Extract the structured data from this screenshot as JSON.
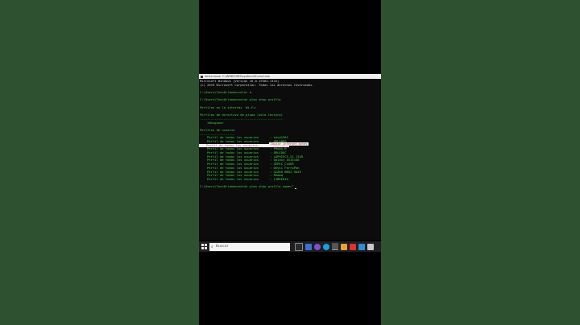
{
  "window": {
    "title": "Seleccionar C:\\WINDOWS\\system32\\cmd.exe"
  },
  "header_lines": [
    "Microsoft Windows [Versión 10.0.19363.1316]",
    "(c) 2019 Microsoft Corporation. Todos los derechos reservados.",
    "",
    "C:\\Users\\TecnOrlando>color a",
    "",
    "C:\\Users\\TecnOrlando>netsh wlan show profile",
    "",
    "Perfiles en la interfaz  Wi-Fi:",
    "",
    "Perfiles de directiva de grupo (solo lectura)",
    "---------------------------------------------",
    "    <Ninguno>",
    "",
    "Perfiles de usuario",
    "-------------------"
  ],
  "profiles": [
    {
      "label": "Perfil de todos los usuarios",
      "value": ": sesd1561"
    },
    {
      "label": "Perfil de todos los usuarios",
      "value": ": ORLANDO"
    },
    {
      "label": "Perfil de todos los usuarios",
      "value": ": MEGACABLE"
    },
    {
      "label": "Perfil de todos los usuarios",
      "value": ": PRADA_B"
    },
    {
      "label": "Perfil de todos los usuarios",
      "value": ": ORLEDOC"
    },
    {
      "label": "Perfil de todos los usuarios",
      "value": ": LAPHIECS-21 1349"
    },
    {
      "label": "Perfil de todos los usuarios",
      "value": ": Galaxy A51E180"
    },
    {
      "label": "Perfil de todos los usuarios",
      "value": ": GEPEC_CLAER"
    },
    {
      "label": "Perfil de todos los usuarios",
      "value": ": Deysi FerroPan"
    },
    {
      "label": "Perfil de todos los usuarios",
      "value": ": GCARO BNS2-9A5E"
    },
    {
      "label": "Perfil de todos los usuarios",
      "value": ": Remaq"
    },
    {
      "label": "Perfil de todos los usuarios",
      "value": ": LIBRERIA"
    }
  ],
  "selected_profile_index": 2,
  "suggestion": "Copiar  Internet antes",
  "prompt_line": "C:\\Users\\TecnOrlando>netsh wlan show profile name=\"",
  "taskbar": {
    "search_placeholder": "Buscar"
  },
  "colors": {
    "console_text": "#3fd94a",
    "highlight": "#e33aa0",
    "background": "#0c0c0c"
  }
}
